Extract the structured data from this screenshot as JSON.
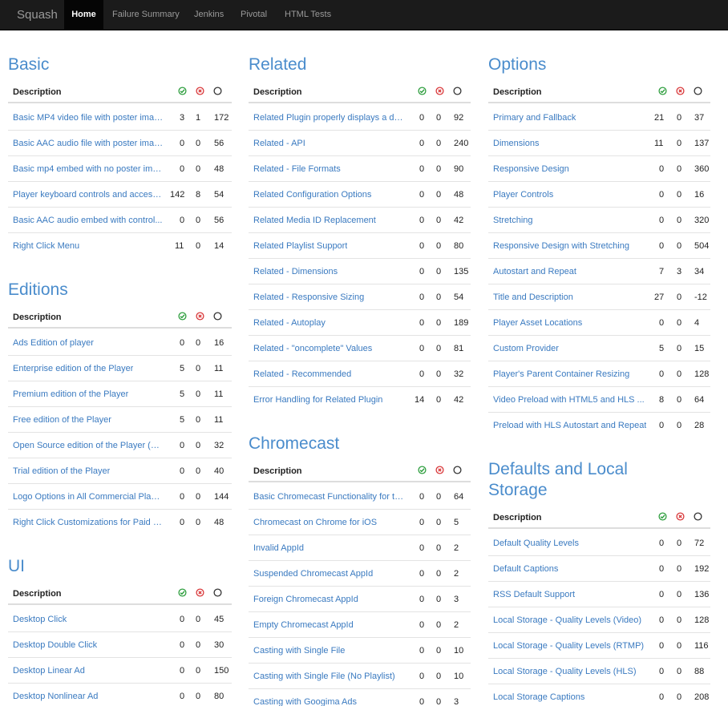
{
  "nav": {
    "brand": "Squash",
    "items": [
      "Home",
      "Failure Summary",
      "Jenkins",
      "Pivotal",
      "HTML Tests"
    ]
  },
  "colors": {
    "accent": "#4a8ccc",
    "link": "#3a7ac0",
    "pass": "#2e9e3e",
    "fail": "#d9383a",
    "navbar": "#1b1b1b"
  },
  "icons": {
    "pass": "check-circle-icon",
    "fail": "x-circle-icon",
    "pending": "empty-circle-icon"
  },
  "table_header": "Description",
  "sections": [
    {
      "title": "Basic",
      "rows": [
        [
          "Basic MP4 video file with poster image",
          "3",
          "1",
          "172"
        ],
        [
          "Basic AAC audio file with poster image",
          "0",
          "0",
          "56"
        ],
        [
          "Basic mp4 embed with no poster image",
          "0",
          "0",
          "48"
        ],
        [
          "Player keyboard controls and accessi...",
          "142",
          "8",
          "54"
        ],
        [
          "Basic AAC audio embed with control...",
          "0",
          "0",
          "56"
        ],
        [
          "Right Click Menu",
          "11",
          "0",
          "14"
        ]
      ]
    },
    {
      "title": "Editions",
      "rows": [
        [
          "Ads Edition of player",
          "0",
          "0",
          "16"
        ],
        [
          "Enterprise edition of the Player",
          "5",
          "0",
          "11"
        ],
        [
          "Premium edition of the Player",
          "5",
          "0",
          "11"
        ],
        [
          "Free edition of the Player",
          "5",
          "0",
          "11"
        ],
        [
          "Open Source edition of the Player (Te...",
          "0",
          "0",
          "32"
        ],
        [
          "Trial edition of the Player",
          "0",
          "0",
          "40"
        ],
        [
          "Logo Options in All Commercial Playe...",
          "0",
          "0",
          "144"
        ],
        [
          "Right Click Customizations for Paid V...",
          "0",
          "0",
          "48"
        ]
      ]
    },
    {
      "title": "UI",
      "rows": [
        [
          "Desktop Click",
          "0",
          "0",
          "45"
        ],
        [
          "Desktop Double Click",
          "0",
          "0",
          "30"
        ],
        [
          "Desktop Linear Ad",
          "0",
          "0",
          "150"
        ],
        [
          "Desktop Nonlinear Ad",
          "0",
          "0",
          "80"
        ]
      ]
    },
    {
      "title": "Related",
      "rows": [
        [
          "Related Plugin properly displays a do...",
          "0",
          "0",
          "92"
        ],
        [
          "Related - API",
          "0",
          "0",
          "240"
        ],
        [
          "Related - File Formats",
          "0",
          "0",
          "90"
        ],
        [
          "Related Configuration Options",
          "0",
          "0",
          "48"
        ],
        [
          "Related Media ID Replacement",
          "0",
          "0",
          "42"
        ],
        [
          "Related Playlist Support",
          "0",
          "0",
          "80"
        ],
        [
          "Related - Dimensions",
          "0",
          "0",
          "135"
        ],
        [
          "Related - Responsive Sizing",
          "0",
          "0",
          "54"
        ],
        [
          "Related - Autoplay",
          "0",
          "0",
          "189"
        ],
        [
          "Related - \"oncomplete\" Values",
          "0",
          "0",
          "81"
        ],
        [
          "Related - Recommended",
          "0",
          "0",
          "32"
        ],
        [
          "Error Handling for Related Plugin",
          "14",
          "0",
          "42"
        ]
      ]
    },
    {
      "title": "Chromecast",
      "rows": [
        [
          "Basic Chromecast Functionality for th...",
          "0",
          "0",
          "64"
        ],
        [
          "Chromecast on Chrome for iOS",
          "0",
          "0",
          "5"
        ],
        [
          "Invalid AppId",
          "0",
          "0",
          "2"
        ],
        [
          "Suspended Chromecast AppId",
          "0",
          "0",
          "2"
        ],
        [
          "Foreign Chromecast AppId",
          "0",
          "0",
          "3"
        ],
        [
          "Empty Chromecast AppId",
          "0",
          "0",
          "2"
        ],
        [
          "Casting with Single File",
          "0",
          "0",
          "10"
        ],
        [
          "Casting with Single File (No Playlist)",
          "0",
          "0",
          "10"
        ],
        [
          "Casting with Googima Ads",
          "0",
          "0",
          "3"
        ]
      ]
    },
    {
      "title": "Options",
      "rows": [
        [
          "Primary and Fallback",
          "21",
          "0",
          "37"
        ],
        [
          "Dimensions",
          "11",
          "0",
          "137"
        ],
        [
          "Responsive Design",
          "0",
          "0",
          "360"
        ],
        [
          "Player Controls",
          "0",
          "0",
          "16"
        ],
        [
          "Stretching",
          "0",
          "0",
          "320"
        ],
        [
          "Responsive Design with Stretching",
          "0",
          "0",
          "504"
        ],
        [
          "Autostart and Repeat",
          "7",
          "3",
          "34"
        ],
        [
          "Title and Description",
          "27",
          "0",
          "-12"
        ],
        [
          "Player Asset Locations",
          "0",
          "0",
          "4"
        ],
        [
          "Custom Provider",
          "5",
          "0",
          "15"
        ],
        [
          "Player's Parent Container Resizing",
          "0",
          "0",
          "128"
        ],
        [
          "Video Preload with HTML5 and HLS ...",
          "8",
          "0",
          "64"
        ],
        [
          "Preload with HLS Autostart and Repeat",
          "0",
          "0",
          "28"
        ]
      ]
    },
    {
      "title": "Defaults and Local Storage",
      "rows": [
        [
          "Default Quality Levels",
          "0",
          "0",
          "72"
        ],
        [
          "Default Captions",
          "0",
          "0",
          "192"
        ],
        [
          "RSS Default Support",
          "0",
          "0",
          "136"
        ],
        [
          "Local Storage - Quality Levels (Video)",
          "0",
          "0",
          "128"
        ],
        [
          "Local Storage - Quality Levels (RTMP)",
          "0",
          "0",
          "116"
        ],
        [
          "Local Storage - Quality Levels (HLS)",
          "0",
          "0",
          "88"
        ],
        [
          "Local Storage Captions",
          "0",
          "0",
          "208"
        ]
      ]
    }
  ]
}
